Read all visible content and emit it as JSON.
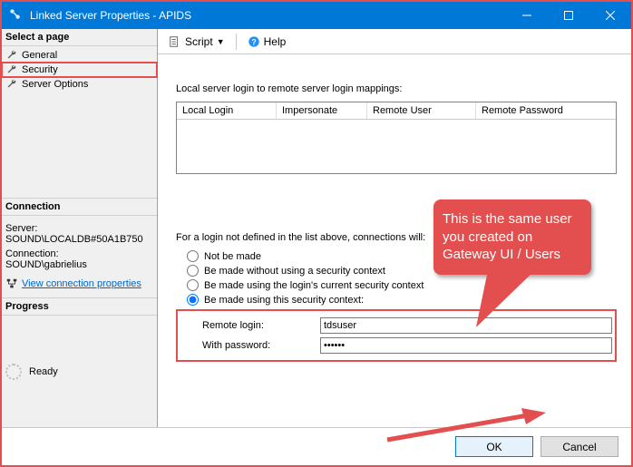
{
  "window": {
    "title": "Linked Server Properties - APIDS"
  },
  "left": {
    "select_page": "Select a page",
    "items": [
      {
        "label": "General"
      },
      {
        "label": "Security"
      },
      {
        "label": "Server Options"
      }
    ],
    "connection_head": "Connection",
    "server_label": "Server:",
    "server_value": "SOUND\\LOCALDB#50A1B750",
    "conn_label": "Connection:",
    "conn_value": "SOUND\\gabrielius",
    "vcp": "View connection properties",
    "progress_head": "Progress",
    "ready": "Ready"
  },
  "toolbar": {
    "script": "Script",
    "help": "Help"
  },
  "content": {
    "mappings_caption": "Local server login to remote server login mappings:",
    "cols": {
      "c1": "Local Login",
      "c2": "Impersonate",
      "c3": "Remote User",
      "c4": "Remote Password"
    },
    "prompt": "For a login not defined in the list above, connections will:",
    "opt1": "Not be made",
    "opt2": "Be made without using a security context",
    "opt3": "Be made using the login's current security context",
    "opt4": "Be made using this security context:",
    "remote_login_label": "Remote login:",
    "with_password_label": "With password:",
    "remote_login_value": "tdsuser",
    "with_password_value": "••••••"
  },
  "footer": {
    "ok": "OK",
    "cancel": "Cancel"
  },
  "callout": {
    "text": "This is the same user you created on Gateway UI / Users"
  },
  "colors": {
    "accent": "#0078d7",
    "annotation": "#e34e4e"
  }
}
